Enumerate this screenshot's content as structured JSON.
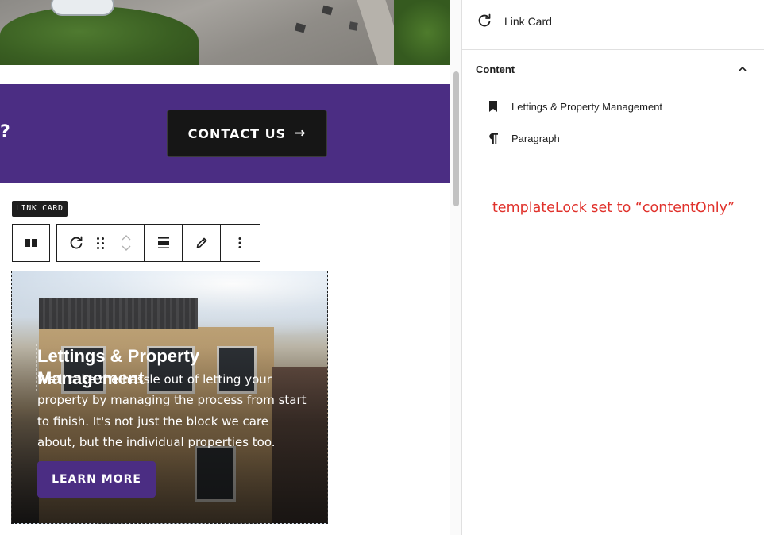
{
  "canvas": {
    "cta_band": {
      "question_tail": "?",
      "contact_label": "CONTACT US",
      "contact_arrow": "→",
      "color": "#4b2d83"
    },
    "block_label": "LINK CARD",
    "toolbar": {
      "icons": [
        "columns-icon",
        "refresh-icon",
        "drag-handle-icon",
        "move-up-icon",
        "move-down-icon",
        "align-icon",
        "edit-icon",
        "more-options-icon"
      ]
    },
    "link_card": {
      "title": "Lettings & Property Management",
      "text": "We'll take the hassle out of letting your property by managing the process from start to finish. It's not just the block we care about, but the individual properties too.",
      "button_label": "LEARN MORE",
      "button_color": "#4b2d83"
    }
  },
  "sidebar": {
    "title": "Link Card",
    "panel_title": "Content",
    "items": [
      {
        "label": "Lettings & Property Management",
        "icon": "bookmark-icon"
      },
      {
        "label": "Paragraph",
        "icon": "paragraph-icon"
      }
    ],
    "note": "templateLock set to “contentOnly”",
    "note_color": "#e0312b"
  }
}
